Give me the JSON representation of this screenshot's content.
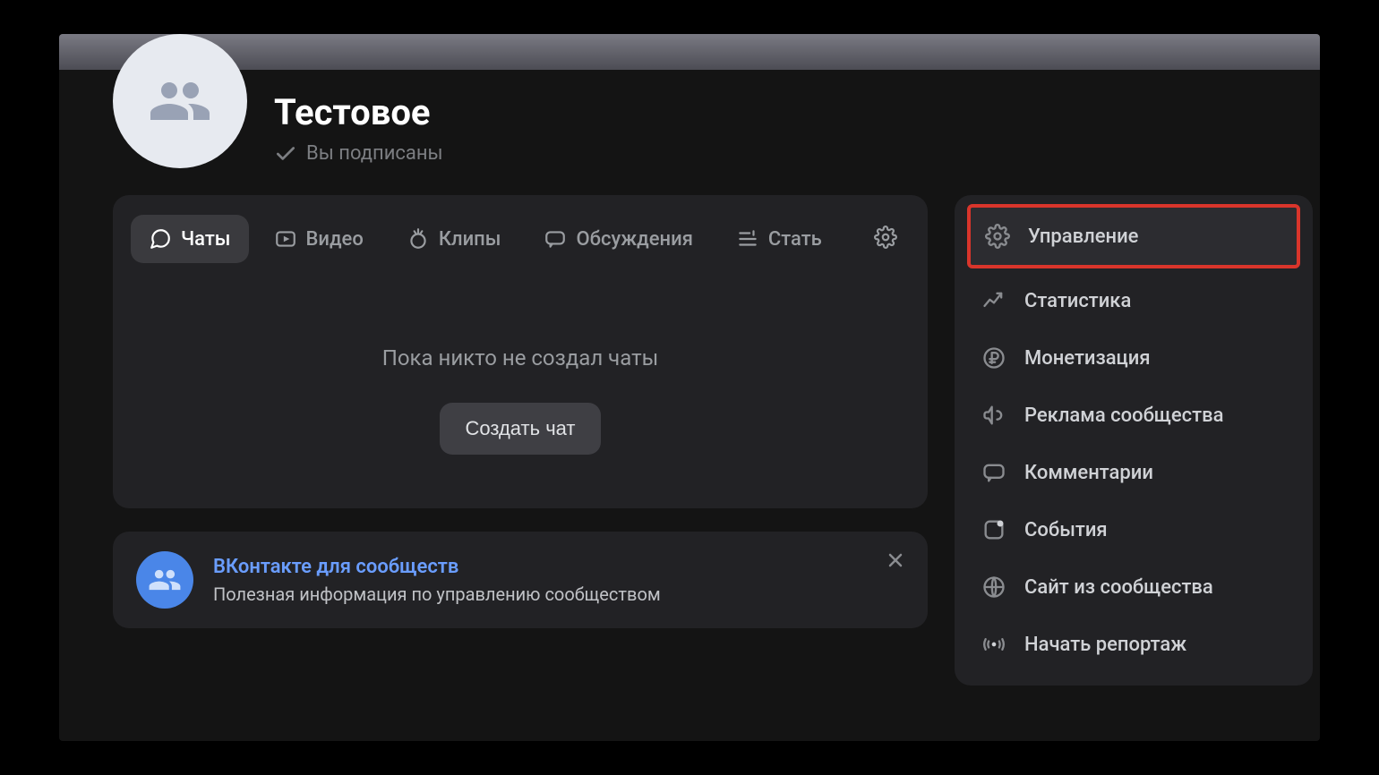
{
  "header": {
    "title": "Тестовое",
    "subscribed_label": "Вы подписаны"
  },
  "tabs": {
    "chats": "Чаты",
    "video": "Видео",
    "clips": "Клипы",
    "discussions": "Обсуждения",
    "articles": "Стать"
  },
  "main": {
    "empty_message": "Пока никто не создал чаты",
    "create_button": "Создать чат"
  },
  "promo": {
    "title": "ВКонтакте для сообществ",
    "subtitle": "Полезная информация по управлению сообществом"
  },
  "sidebar": {
    "items": [
      {
        "label": "Управление"
      },
      {
        "label": "Статистика"
      },
      {
        "label": "Монетизация"
      },
      {
        "label": "Реклама сообщества"
      },
      {
        "label": "Комментарии"
      },
      {
        "label": "События"
      },
      {
        "label": "Сайт из сообщества"
      },
      {
        "label": "Начать репортаж"
      }
    ]
  }
}
